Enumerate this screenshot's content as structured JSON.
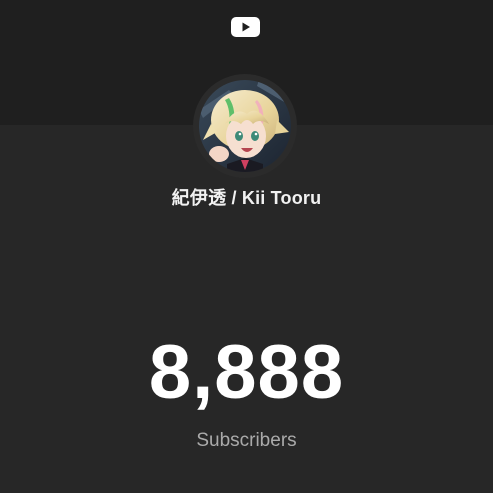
{
  "channel": {
    "name": "紀伊透 / Kii Tooru"
  },
  "stats": {
    "subscriber_count": "8,888",
    "subscriber_label": "Subscribers"
  },
  "icons": {
    "logo": "youtube-icon",
    "avatar": "channel-avatar"
  },
  "colors": {
    "background": "#272727",
    "header_band": "#1f1f1f",
    "text_primary": "#ffffff",
    "text_secondary": "#aaaaaa"
  }
}
